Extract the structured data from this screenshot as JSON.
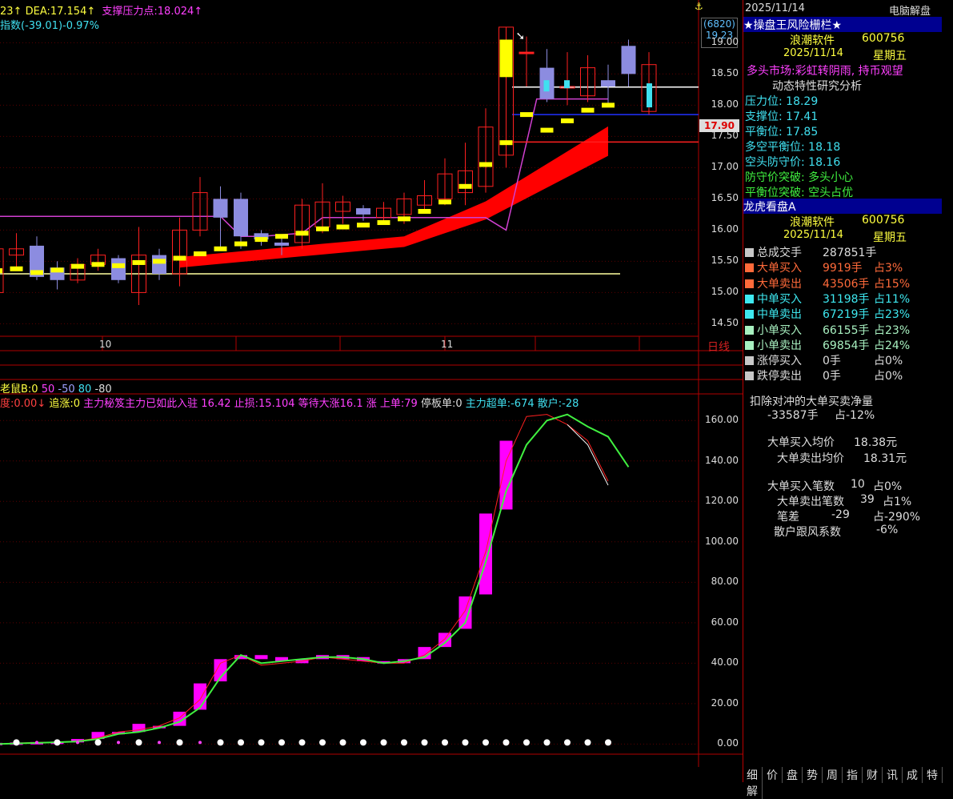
{
  "price_header": {
    "dea_prefix": "23",
    "dea_label": "DEA:17.154",
    "support_label": "支撑压力点:18.024",
    "index_label": "指数(-39.01)-0.97%",
    "arrow": "↑"
  },
  "volume_header": {
    "name": "老鼠B:0",
    "v1": "50",
    "v2": "-50",
    "v3": "80",
    "v4": "-80"
  },
  "indicator_header": {
    "left": "度:0.00",
    "arrow": "↓",
    "chase": "追涨:0",
    "hidden": "主力秘笈主力已如此入驻 16.42 止损:15.104 等待大涨16.1 涨 上单:79",
    "stop": "停板单:0",
    "super": "主力超单:-674",
    "retail": "散户:-28"
  },
  "price_axis": {
    "ticks": [
      "19.00",
      "18.50",
      "18.00",
      "17.50",
      "17.00",
      "16.50",
      "16.00",
      "15.50",
      "15.00",
      "14.50"
    ],
    "top_code": "(6820)",
    "top_price": "19.23",
    "current_price": "17.90",
    "period": "日线"
  },
  "x_axis": {
    "labels": [
      "10",
      "11"
    ]
  },
  "indicator_axis": {
    "ticks": [
      "160.00",
      "140.00",
      "120.00",
      "100.00",
      "80.00",
      "60.00",
      "40.00",
      "20.00",
      "0.00"
    ]
  },
  "panel": {
    "date": "2025/11/14",
    "mode": "电脑解盘",
    "risk_title": "★操盘王风险栅栏★",
    "stock1": "浪潮软件",
    "code1": "600756",
    "date2": "2025/11/14",
    "weekday2": "星期五",
    "market": "多头市场:彩虹转阴雨, 持币观望",
    "analysis": "动态特性研究分析",
    "pressure": "压力位: 18.29",
    "support": "支撑位: 17.41",
    "balance": "平衡位: 17.85",
    "ls_balance": "多空平衡位: 18.18",
    "short_defense": "空头防守价: 18.16",
    "defense_break": "防守价突破: 多头小心",
    "balance_break": "平衡位突破: 空头占优",
    "dragon_title": "龙虎看盘A",
    "stock2": "浪潮软件",
    "code2": "600756",
    "date3": "2025/11/14",
    "weekday3": "星期五",
    "flows": [
      {
        "name": "总成交手",
        "value": "287851手",
        "pct": "",
        "color": "#c8c8c8",
        "vcolor": "#ddd"
      },
      {
        "name": "大单买入",
        "value": "9919手",
        "pct": "占3%",
        "color": "#ff6a3a",
        "vcolor": "#ff6a3a"
      },
      {
        "name": "大单卖出",
        "value": "43506手",
        "pct": "占15%",
        "color": "#ff6a3a",
        "vcolor": "#ff6a3a"
      },
      {
        "name": "中单买入",
        "value": "31198手",
        "pct": "占11%",
        "color": "#3ee8f0",
        "vcolor": "#3ee8f0"
      },
      {
        "name": "中单卖出",
        "value": "67219手",
        "pct": "占23%",
        "color": "#3ee8f0",
        "vcolor": "#3ee8f0"
      },
      {
        "name": "小单买入",
        "value": "66155手",
        "pct": "占23%",
        "color": "#a8f0c0",
        "vcolor": "#a8f0c0"
      },
      {
        "name": "小单卖出",
        "value": "69854手",
        "pct": "占24%",
        "color": "#a8f0c0",
        "vcolor": "#a8f0c0"
      },
      {
        "name": "涨停买入",
        "value": "0手",
        "pct": "占0%",
        "color": "#c8c8c8",
        "vcolor": "#ddd"
      },
      {
        "name": "跌停卖出",
        "value": "0手",
        "pct": "占0%",
        "color": "#c8c8c8",
        "vcolor": "#ddd"
      }
    ],
    "net_title": "扣除对冲的大单买卖净量",
    "net_value": "-33587手",
    "net_pct": "占-12%",
    "buy_avg_label": "大单买入均价",
    "buy_avg": "18.38元",
    "sell_avg_label": "大单卖出均价",
    "sell_avg": "18.31元",
    "buy_cnt_label": "大单买入笔数",
    "buy_cnt": "10",
    "buy_cnt_pct": "占0%",
    "sell_cnt_label": "大单卖出笔数",
    "sell_cnt": "39",
    "sell_cnt_pct": "占1%",
    "diff_label": "笔差",
    "diff": "-29",
    "diff_pct": "占-290%",
    "retail_label": "散户跟风系数",
    "retail_val": "-6%",
    "nav": [
      "细",
      "价",
      "盘",
      "势",
      "周",
      "指",
      "财",
      "讯",
      "成",
      "特",
      "解"
    ]
  },
  "chart_data": [
    {
      "type": "candlestick",
      "title": "",
      "ylim": [
        14.3,
        19.3
      ],
      "y_ticks": [
        19.0,
        18.5,
        18.0,
        17.5,
        17.0,
        16.5,
        16.0,
        15.5,
        15.0,
        14.5
      ],
      "x_labels": [
        {
          "index": 5,
          "label": "10"
        },
        {
          "index": 22,
          "label": "11"
        }
      ],
      "candles": [
        {
          "o": 15.0,
          "c": 15.7,
          "h": 15.85,
          "l": 14.9
        },
        {
          "o": 15.6,
          "c": 15.7,
          "h": 15.95,
          "l": 15.4
        },
        {
          "o": 15.75,
          "c": 15.25,
          "h": 15.9,
          "l": 15.2
        },
        {
          "o": 15.4,
          "c": 15.2,
          "h": 15.5,
          "l": 15.05
        },
        {
          "o": 15.2,
          "c": 15.45,
          "h": 15.55,
          "l": 15.15
        },
        {
          "o": 15.45,
          "c": 15.6,
          "h": 15.7,
          "l": 15.35
        },
        {
          "o": 15.55,
          "c": 15.2,
          "h": 15.6,
          "l": 15.15
        },
        {
          "o": 15.0,
          "c": 15.6,
          "h": 16.05,
          "l": 14.8
        },
        {
          "o": 15.6,
          "c": 15.3,
          "h": 15.7,
          "l": 15.2
        },
        {
          "o": 15.3,
          "c": 16.0,
          "h": 16.2,
          "l": 15.1
        },
        {
          "o": 16.0,
          "c": 16.6,
          "h": 16.85,
          "l": 15.9
        },
        {
          "o": 16.5,
          "c": 16.2,
          "h": 16.7,
          "l": 15.7
        },
        {
          "o": 16.5,
          "c": 15.9,
          "h": 16.6,
          "l": 15.7
        },
        {
          "o": 15.95,
          "c": 15.85,
          "h": 16.0,
          "l": 15.75
        },
        {
          "o": 15.8,
          "c": 15.75,
          "h": 15.9,
          "l": 15.6
        },
        {
          "o": 15.8,
          "c": 16.4,
          "h": 16.5,
          "l": 15.7
        },
        {
          "o": 16.05,
          "c": 16.45,
          "h": 16.75,
          "l": 15.95
        },
        {
          "o": 16.3,
          "c": 16.45,
          "h": 16.55,
          "l": 16.1
        },
        {
          "o": 16.35,
          "c": 16.25,
          "h": 16.4,
          "l": 16.15
        },
        {
          "o": 16.2,
          "c": 16.35,
          "h": 16.45,
          "l": 16.1
        },
        {
          "o": 16.25,
          "c": 16.5,
          "h": 16.6,
          "l": 16.1
        },
        {
          "o": 16.4,
          "c": 16.55,
          "h": 16.8,
          "l": 16.3
        },
        {
          "o": 16.5,
          "c": 16.9,
          "h": 17.15,
          "l": 16.4
        },
        {
          "o": 16.6,
          "c": 16.95,
          "h": 17.4,
          "l": 16.4
        },
        {
          "o": 16.7,
          "c": 17.65,
          "h": 17.95,
          "l": 16.6
        },
        {
          "o": 17.2,
          "c": 19.25,
          "h": 19.25,
          "l": 17.0
        },
        {
          "o": 18.85,
          "c": 18.85,
          "h": 19.1,
          "l": 18.3
        },
        {
          "o": 18.6,
          "c": 18.1,
          "h": 18.9,
          "l": 18.05
        },
        {
          "o": 18.3,
          "c": 18.3,
          "h": 18.85,
          "l": 18.0
        },
        {
          "o": 18.15,
          "c": 18.6,
          "h": 18.8,
          "l": 18.05
        },
        {
          "o": 18.4,
          "c": 18.3,
          "h": 18.65,
          "l": 18.0
        },
        {
          "o": 18.95,
          "c": 18.5,
          "h": 19.05,
          "l": 18.3
        },
        {
          "o": 17.9,
          "c": 18.65,
          "h": 18.85,
          "l": 17.85
        }
      ],
      "bull_color": "#ff2020",
      "bear_color": "#8c8ce0",
      "band_color": "#ff0000",
      "ma_color": "#ffff00"
    },
    {
      "type": "bar",
      "title": "",
      "ylim": [
        -5,
        170
      ],
      "y_ticks": [
        160,
        140,
        120,
        100,
        80,
        60,
        40,
        20,
        0
      ],
      "bars": [
        {
          "i": 0,
          "lo": 0,
          "hi": 0.6
        },
        {
          "i": 1,
          "lo": 0.2,
          "hi": 0.8
        },
        {
          "i": 2,
          "lo": 0.3,
          "hi": 1
        },
        {
          "i": 3,
          "lo": 0.5,
          "hi": 1.2
        },
        {
          "i": 4,
          "lo": 0.8,
          "hi": 2.5
        },
        {
          "i": 5,
          "lo": 2.5,
          "hi": 6
        },
        {
          "i": 6,
          "lo": 5,
          "hi": 6
        },
        {
          "i": 7,
          "lo": 6,
          "hi": 10
        },
        {
          "i": 8,
          "lo": 8,
          "hi": 9
        },
        {
          "i": 9,
          "lo": 9,
          "hi": 16
        },
        {
          "i": 10,
          "lo": 17,
          "hi": 30
        },
        {
          "i": 11,
          "lo": 31,
          "hi": 42
        },
        {
          "i": 12,
          "lo": 42,
          "hi": 44
        },
        {
          "i": 13,
          "lo": 42,
          "hi": 44
        },
        {
          "i": 14,
          "lo": 41,
          "hi": 43
        },
        {
          "i": 15,
          "lo": 40,
          "hi": 42
        },
        {
          "i": 16,
          "lo": 42,
          "hi": 44
        },
        {
          "i": 17,
          "lo": 42,
          "hi": 44
        },
        {
          "i": 18,
          "lo": 41,
          "hi": 43
        },
        {
          "i": 19,
          "lo": 40,
          "hi": 41
        },
        {
          "i": 20,
          "lo": 40,
          "hi": 42
        },
        {
          "i": 21,
          "lo": 42,
          "hi": 48
        },
        {
          "i": 22,
          "lo": 48,
          "hi": 55
        },
        {
          "i": 23,
          "lo": 57,
          "hi": 73
        },
        {
          "i": 24,
          "lo": 74,
          "hi": 114
        },
        {
          "i": 25,
          "lo": 116,
          "hi": 150
        }
      ],
      "red_line": [
        0,
        0.5,
        0.8,
        1,
        1.5,
        3,
        6,
        7,
        9,
        13,
        22,
        40,
        44,
        39,
        40,
        41,
        43,
        42,
        41,
        40,
        40,
        44,
        52,
        66,
        95,
        140,
        162,
        163,
        158,
        150,
        130
      ],
      "green_line": [
        0,
        0.3,
        0.6,
        0.9,
        1.3,
        2.5,
        5,
        6,
        8,
        11,
        18,
        33,
        44,
        40,
        41,
        42,
        43,
        43,
        42,
        40,
        41,
        43,
        50,
        60,
        90,
        125,
        148,
        160,
        163,
        157,
        152,
        137
      ],
      "bar_color": "#ff00ff"
    }
  ]
}
